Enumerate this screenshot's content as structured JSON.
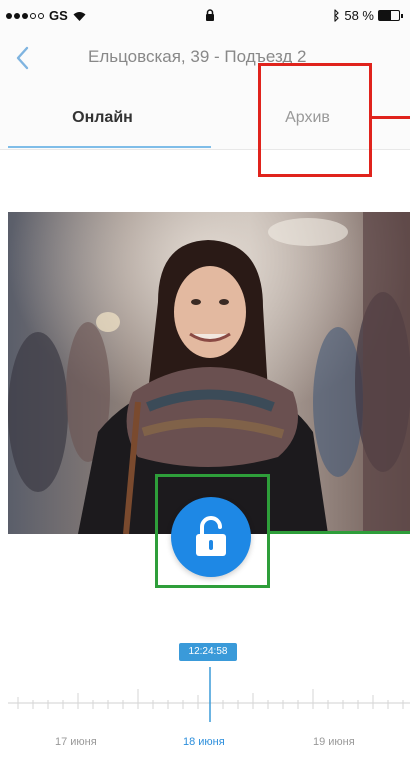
{
  "status_bar": {
    "carrier": "GS",
    "battery_percent": "58 %",
    "battery_level": 0.58
  },
  "nav": {
    "title": "Ельцовская, 39 - Подъезд 2",
    "back_icon": "chevron-left-icon"
  },
  "tabs": [
    {
      "label": "Онлайн",
      "active": true
    },
    {
      "label": "Архив",
      "active": false
    }
  ],
  "unlock": {
    "icon": "unlock-icon"
  },
  "timeline": {
    "current_time": "12:24:58",
    "days": [
      {
        "label": "17 июня",
        "active": false
      },
      {
        "label": "18 июня",
        "active": true
      },
      {
        "label": "19 июня",
        "active": false
      }
    ]
  },
  "colors": {
    "accent": "#1e88e5",
    "tab_underline": "#7fbde8",
    "annotation_red": "#e0231c",
    "annotation_green": "#2e9e3a"
  }
}
